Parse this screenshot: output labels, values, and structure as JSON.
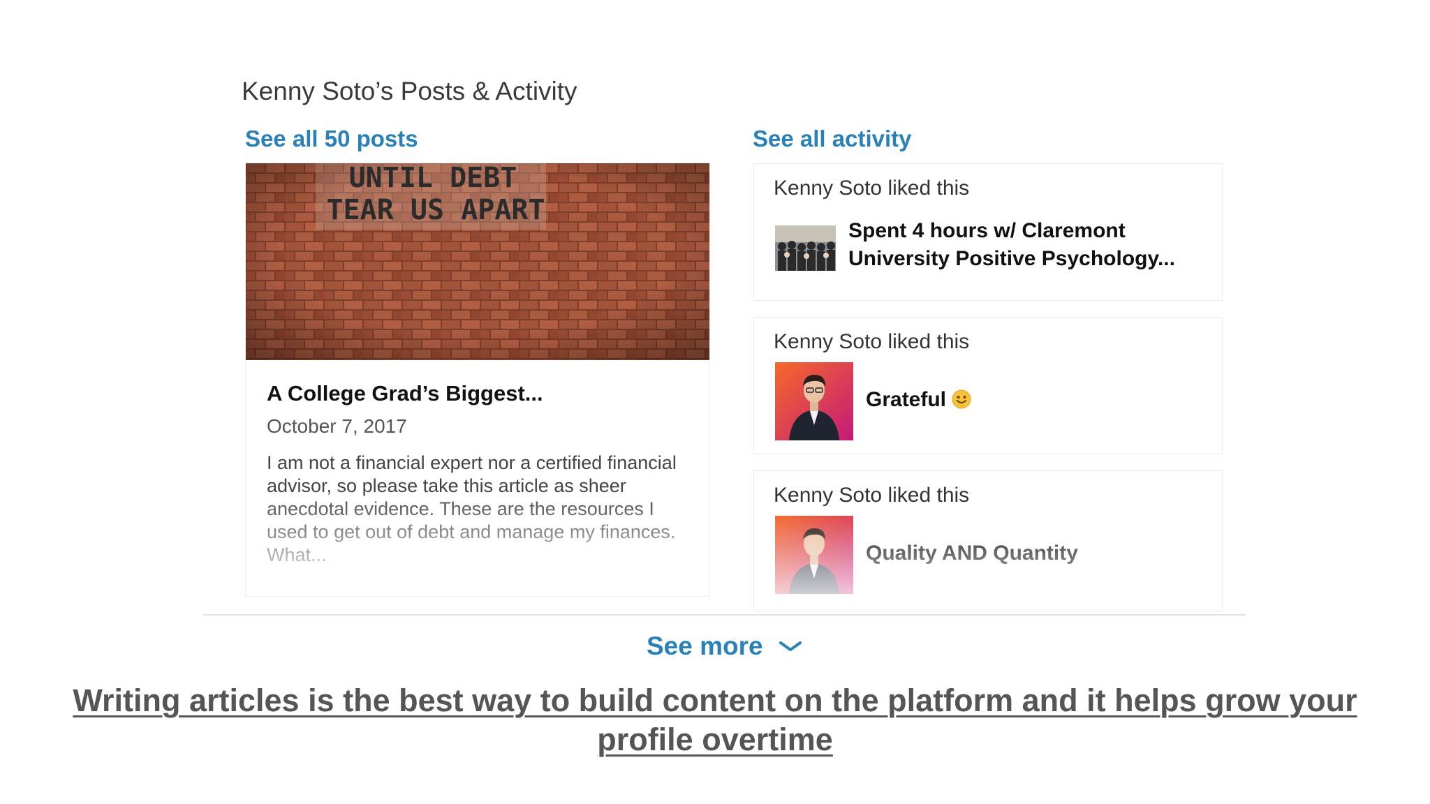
{
  "section": {
    "title": "Kenny Soto’s Posts & Activity",
    "see_all_posts": "See all 50 posts",
    "see_all_activity": "See all activity"
  },
  "post": {
    "image_text_line1": "UNTIL DEBT",
    "image_text_line2": "TEAR US APART",
    "title": "A College Grad’s Biggest...",
    "date": "October 7, 2017",
    "excerpt": "I am not a financial expert nor a certified financial advisor, so please take this article as sheer anecdotal evidence. These are the resources I used to get out of debt and manage my finances. What..."
  },
  "activity": [
    {
      "who": "Kenny Soto liked this",
      "text": "Spent 4 hours w/ Claremont University Positive Psychology...",
      "thumb_icon": "group-photo-icon"
    },
    {
      "who": "Kenny Soto liked this",
      "text": "Grateful",
      "emoji_icon": "smiley-icon",
      "thumb_icon": "profile-photo-icon"
    },
    {
      "who": "Kenny Soto liked this",
      "text": "Quality AND Quantity",
      "thumb_icon": "profile-photo-icon"
    }
  ],
  "see_more": "See more",
  "caption": "Writing articles is the best way to build content on the platform and it helps grow your profile overtime",
  "colors": {
    "link_blue": "#2a80b9",
    "brick": "#a1543a",
    "thumb_gradient_start": "#f56a2a",
    "thumb_gradient_end": "#c41a7a"
  }
}
